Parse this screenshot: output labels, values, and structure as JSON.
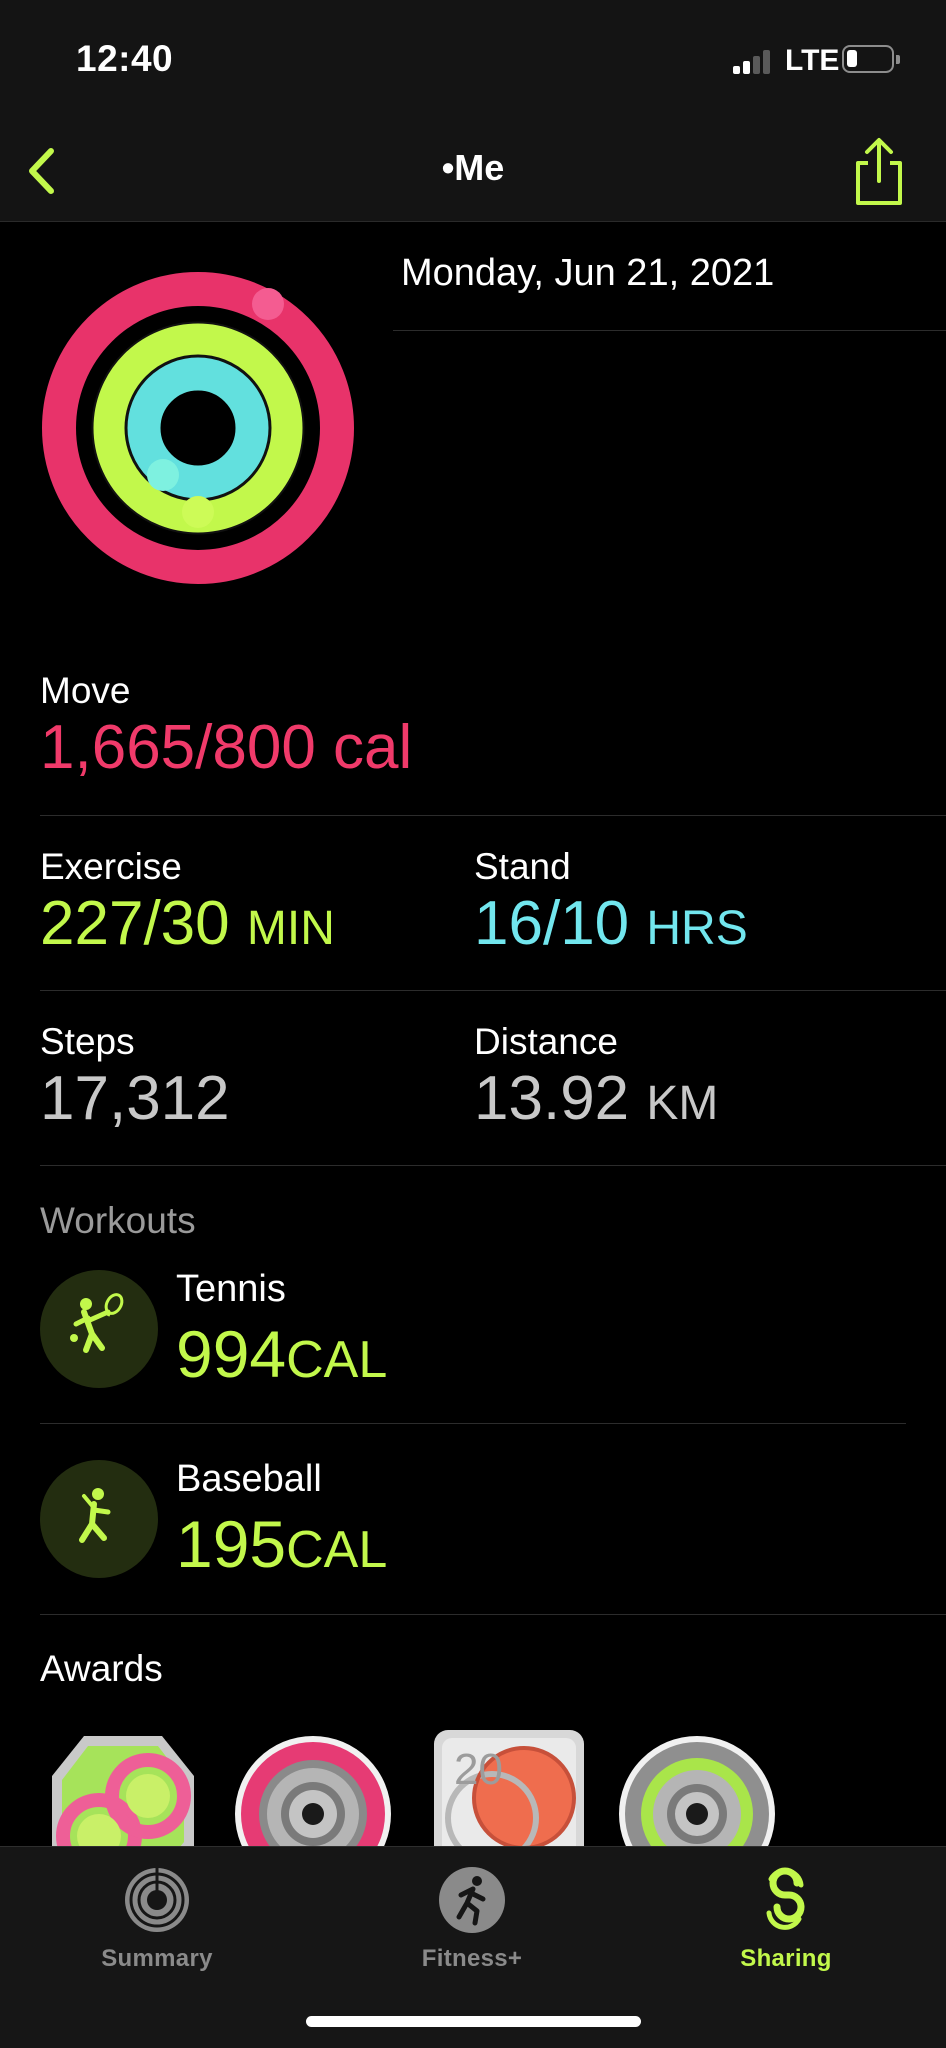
{
  "status_bar": {
    "time": "12:40",
    "network": "LTE"
  },
  "nav": {
    "title": "•Me"
  },
  "summary": {
    "date": "Monday, Jun 21, 2021"
  },
  "colors": {
    "move": "#f03a6a",
    "exercise": "#c2f84b",
    "stand": "#72e6ee",
    "accent": "#c2f84b"
  },
  "stats": {
    "move": {
      "label": "Move",
      "value": "1,665/800 cal"
    },
    "exercise": {
      "label": "Exercise",
      "value": "227/30",
      "unit": "MIN"
    },
    "stand": {
      "label": "Stand",
      "value": "16/10",
      "unit": "HRS"
    },
    "steps": {
      "label": "Steps",
      "value": "17,312"
    },
    "distance": {
      "label": "Distance",
      "value": "13.92",
      "unit": "KM"
    }
  },
  "workouts": {
    "heading": "Workouts",
    "items": [
      {
        "name": "Tennis",
        "value": "994",
        "unit": "CAL",
        "icon": "tennis-icon"
      },
      {
        "name": "Baseball",
        "value": "195",
        "unit": "CAL",
        "icon": "baseball-icon"
      }
    ]
  },
  "awards": {
    "heading": "Awards",
    "icons": [
      "infinity-award-icon",
      "move-ring-award-icon",
      "2020-award-icon",
      "exercise-ring-award-icon"
    ]
  },
  "tabs": [
    {
      "label": "Summary",
      "icon": "summary-rings-icon",
      "active": false
    },
    {
      "label": "Fitness+",
      "icon": "fitness-plus-icon",
      "active": false
    },
    {
      "label": "Sharing",
      "icon": "sharing-icon",
      "active": true
    }
  ]
}
